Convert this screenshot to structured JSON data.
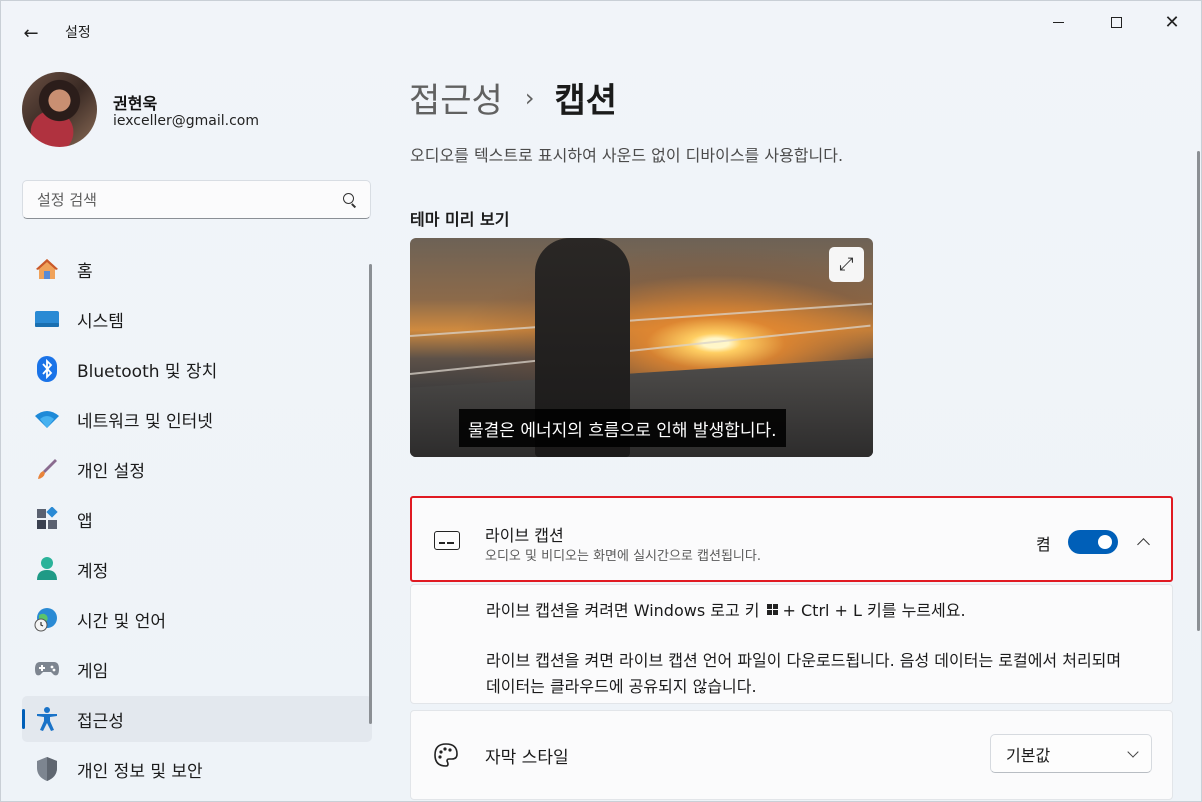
{
  "app": {
    "title": "설정"
  },
  "profile": {
    "name": "권현욱",
    "email": "iexceller@gmail.com"
  },
  "search": {
    "placeholder": "설정 검색"
  },
  "sidebar": {
    "items": [
      {
        "label": "홈",
        "icon": "home-icon"
      },
      {
        "label": "시스템",
        "icon": "system-icon"
      },
      {
        "label": "Bluetooth 및 장치",
        "icon": "bluetooth-icon"
      },
      {
        "label": "네트워크 및 인터넷",
        "icon": "wifi-icon"
      },
      {
        "label": "개인 설정",
        "icon": "brush-icon"
      },
      {
        "label": "앱",
        "icon": "apps-icon"
      },
      {
        "label": "계정",
        "icon": "account-icon"
      },
      {
        "label": "시간 및 언어",
        "icon": "globe-clock-icon"
      },
      {
        "label": "게임",
        "icon": "gamepad-icon"
      },
      {
        "label": "접근성",
        "icon": "accessibility-icon",
        "active": true
      },
      {
        "label": "개인 정보 및 보안",
        "icon": "shield-icon"
      }
    ]
  },
  "breadcrumb": {
    "parent": "접근성",
    "separator": "›",
    "current": "캡션"
  },
  "page": {
    "description": "오디오를 텍스트로 표시하여 사운드 없이 디바이스를 사용합니다."
  },
  "preview": {
    "title": "테마 미리 보기",
    "caption": "물결은 에너지의 흐름으로 인해 발생합니다."
  },
  "live_captions": {
    "title": "라이브 캡션",
    "subtitle": "오디오 및 비디오는 화면에 실시간으로 캡션됩니다.",
    "toggle_label": "켬",
    "enabled": true,
    "line1_before": "라이브 캡션을 켜려면 Windows 로고 키",
    "line1_after": "+ Ctrl + L 키를 누르세요.",
    "line2": "라이브 캡션을 켜면 라이브 캡션 언어 파일이 다운로드됩니다. 음성 데이터는 로컬에서 처리되며 데이터는 클라우드에 공유되지 않습니다."
  },
  "caption_style": {
    "title": "자막 스타일",
    "value": "기본값"
  },
  "colors": {
    "accent": "#005fb8",
    "highlight_border": "#e01a22"
  }
}
